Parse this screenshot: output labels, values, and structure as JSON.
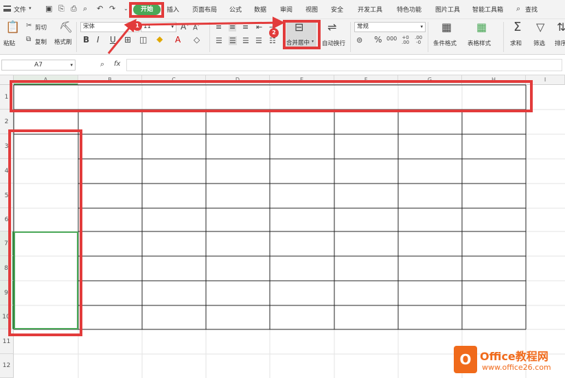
{
  "menu": {
    "file": "文件",
    "tabs": [
      "开始",
      "插入",
      "页面布局",
      "公式",
      "数据",
      "审阅",
      "视图",
      "安全",
      "开发工具",
      "特色功能",
      "图片工具",
      "智能工具箱"
    ],
    "search": "查找"
  },
  "ribbon": {
    "paste": "粘贴",
    "cut": "剪切",
    "copy": "复制",
    "format_painter": "格式刷",
    "font_name": "宋体",
    "font_size": "11",
    "merge_center": "合并居中",
    "wrap_text": "自动换行",
    "number_format": "常规",
    "conditional_format": "条件格式",
    "table_style": "表格样式",
    "sum": "求和",
    "filter": "筛选",
    "sort": "排序"
  },
  "formula_bar": {
    "name_box": "A7",
    "fx": "fx",
    "content": ""
  },
  "sheet": {
    "columns": [
      "A",
      "B",
      "C",
      "D",
      "E",
      "F",
      "G",
      "H",
      "I"
    ],
    "rows": [
      "1",
      "2",
      "3",
      "4",
      "5",
      "6",
      "7",
      "8",
      "9",
      "10",
      "11",
      "12"
    ]
  },
  "annotations": {
    "step1": "1",
    "step2": "2"
  },
  "watermark": {
    "brand": "Office教程网",
    "url": "www.office26.com"
  },
  "colors": {
    "accent_green": "#4aa857",
    "annotation_red": "#e23b3b",
    "brand_orange": "#f06a1b"
  }
}
